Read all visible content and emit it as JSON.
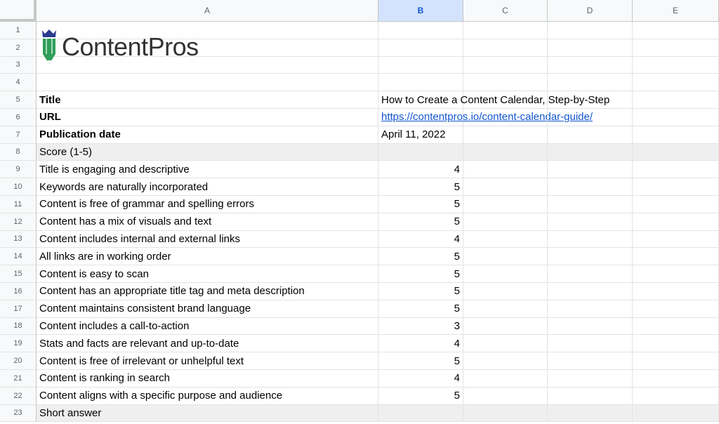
{
  "columns": [
    "A",
    "B",
    "C",
    "D",
    "E"
  ],
  "selected_column": "B",
  "row_numbers": [
    "1",
    "2",
    "3",
    "4",
    "5",
    "6",
    "7",
    "8",
    "9",
    "10",
    "11",
    "12",
    "13",
    "14",
    "15",
    "16",
    "17",
    "18",
    "19",
    "20",
    "21",
    "22",
    "23"
  ],
  "logo": {
    "text": "ContentPros",
    "brand_color": "#2f9e58",
    "crown_color": "#2b3a8f",
    "name_color": "#333333"
  },
  "info": {
    "title_label": "Title",
    "title_value": "How to Create a Content Calendar, Step-by-Step",
    "url_label": "URL",
    "url_value": "https://contentpros.io/content-calendar-guide/",
    "date_label": "Publication date",
    "date_value": "April 11, 2022"
  },
  "score_header": "Score (1-5)",
  "criteria": [
    {
      "label": "Title is engaging and descriptive",
      "score": "4"
    },
    {
      "label": "Keywords are naturally incorporated",
      "score": "5"
    },
    {
      "label": "Content is free of grammar and spelling errors",
      "score": "5"
    },
    {
      "label": "Content has a mix of visuals and text",
      "score": "5"
    },
    {
      "label": "Content includes internal and external links",
      "score": "4"
    },
    {
      "label": "All links are in working order",
      "score": "5"
    },
    {
      "label": "Content is easy to scan",
      "score": "5"
    },
    {
      "label": "Content has an appropriate title tag and meta description",
      "score": "5"
    },
    {
      "label": "Content maintains consistent brand language",
      "score": "5"
    },
    {
      "label": "Content includes a call-to-action",
      "score": "3"
    },
    {
      "label": "Stats and facts are relevant and up-to-date",
      "score": "4"
    },
    {
      "label": "Content is free of irrelevant or unhelpful text",
      "score": "5"
    },
    {
      "label": "Content is ranking in search",
      "score": "4"
    },
    {
      "label": "Content aligns with a specific purpose and audience",
      "score": "5"
    }
  ],
  "short_answer_header": "Short answer"
}
